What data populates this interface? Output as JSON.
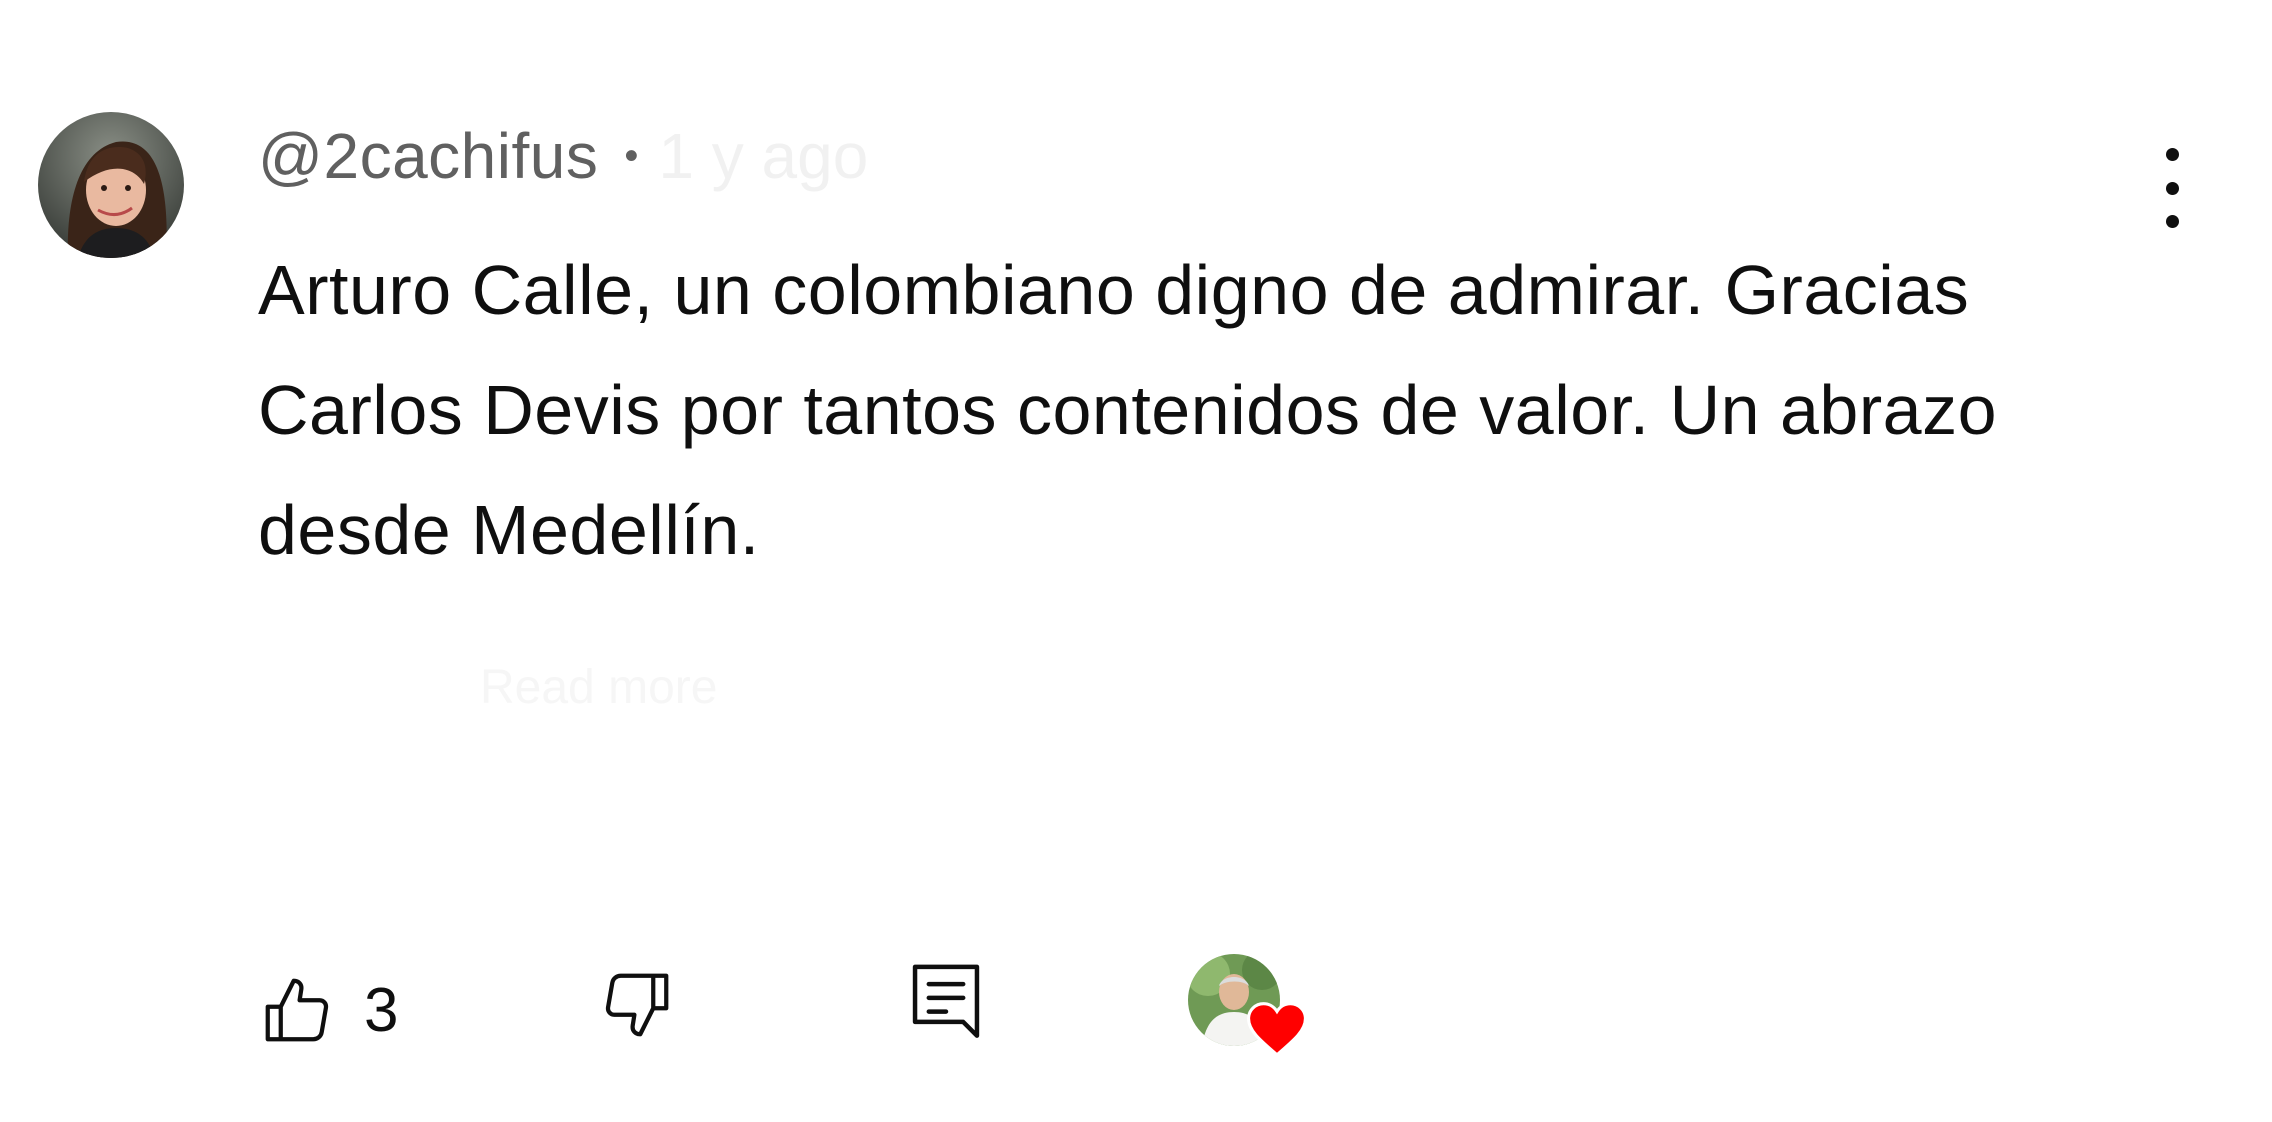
{
  "comment": {
    "username": "@2cachifus",
    "separator": "•",
    "timestamp": "1 y ago",
    "text": "Arturo Calle, un colombiano digno de admirar. Gracias Carlos Devis por tantos contenidos de valor. Un abrazo desde Medellín.",
    "faint_reply_text": "Read more",
    "likes": "3"
  },
  "icons": {
    "like": "thumbs-up-icon",
    "dislike": "thumbs-down-icon",
    "reply": "comment-reply-icon",
    "menu": "more-vertical-icon",
    "heart": "heart-icon"
  },
  "colors": {
    "text_primary": "#0f0f0f",
    "text_secondary": "#606060",
    "heart": "#ff0000"
  }
}
